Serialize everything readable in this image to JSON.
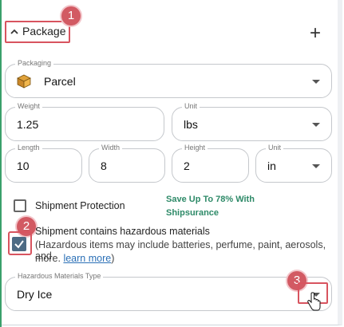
{
  "section": {
    "title": "Package",
    "add_symbol": "+"
  },
  "badges": [
    "1",
    "2",
    "3"
  ],
  "packaging": {
    "label": "Packaging",
    "value": "Parcel",
    "icon": "package-box-icon"
  },
  "weight": {
    "label": "Weight",
    "value": "1.25"
  },
  "weight_unit": {
    "label": "Unit",
    "value": "lbs"
  },
  "length": {
    "label": "Length",
    "value": "10"
  },
  "width": {
    "label": "Width",
    "value": "8"
  },
  "height": {
    "label": "Height",
    "value": "2"
  },
  "dim_unit": {
    "label": "Unit",
    "value": "in"
  },
  "protection": {
    "label": "Shipment Protection",
    "checked": false,
    "promo_line1": "Save Up To 78% With",
    "promo_line2": "Shipsurance"
  },
  "hazardous": {
    "label": "Shipment contains hazardous materials",
    "checked": true,
    "note_line1": "(Hazardous items may include batteries, perfume, paint, aerosols, and",
    "note_line2_prefix": "more. ",
    "note_link": "learn more",
    "note_line2_suffix": ")"
  },
  "hazard_type": {
    "label": "Hazardous Materials Type",
    "value": "Dry Ice"
  },
  "colors": {
    "highlight": "#d8545f",
    "badge": "#d25a63",
    "checkbox_checked": "#4d6b84",
    "promo": "#2e8a68",
    "link": "#2a6fb6"
  }
}
